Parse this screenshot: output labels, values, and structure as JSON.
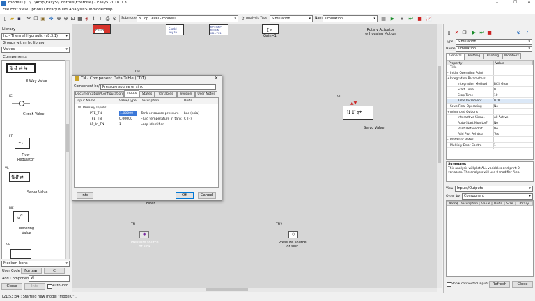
{
  "window": {
    "title": "model0 (C:\\...\\Amp\\Easy5\\Controls\\Exercise) - Easy5 2018.0.3",
    "min": "–",
    "max": "☐",
    "close": "✕"
  },
  "menu": [
    "File",
    "Edit",
    "View",
    "Options",
    "Library",
    "Build",
    "Analysis",
    "Submodel",
    "Help"
  ],
  "toolbar": {
    "submodel_label": "Submodel",
    "submodel_value": "> Top Level - model0",
    "analysis_label": "Analysis Type",
    "analysis_value": "Simulation",
    "name_label": "Name",
    "name_value": "simulation"
  },
  "library_panel": {
    "title": "Library",
    "library_value": "hc - Thermal Hydraulic (v8.3.1)",
    "groups_label": "Groups within hc library",
    "groups_value": "Valves",
    "components_title": "Components",
    "items": [
      {
        "tag": "",
        "name": "8-Way Valve"
      },
      {
        "tag": "IC",
        "name": "Check Valve"
      },
      {
        "tag": "FF",
        "name": "Flow Regulator"
      },
      {
        "tag": "VL",
        "name": "Servo Valve"
      },
      {
        "tag": "MF",
        "name": "Metering Valve"
      },
      {
        "tag": "VF",
        "name": ""
      }
    ],
    "icon_size": "Medium Icons",
    "user_code_label": "User Code",
    "fortran": "Fortran",
    "c": "C",
    "add_component_label": "Add Component",
    "add_component_value": "VI",
    "close": "Close",
    "info": "Info",
    "auto_info": "Auto-Info"
  },
  "canvas": {
    "blocks": [
      {
        "tag": "",
        "name": "Fluid"
      },
      {
        "tag": "",
        "name": "S-add\nkey16"
      },
      {
        "tag": "",
        "name": "CONTROL\nKP=GKP\nKI=GKI\nKD=TC1"
      },
      {
        "tag": "",
        "name": "Gain=1"
      },
      {
        "tag": "",
        "name": "Rotary Actuator\nw Housing Motion"
      },
      {
        "tag": "VI",
        "name": "Servo Valve"
      },
      {
        "tag": "",
        "name": "Filter"
      },
      {
        "tag": "TN",
        "name": "Pressure source\nor sink"
      },
      {
        "tag": "TN2",
        "name": "Pressure source\nor sink"
      }
    ],
    "ch_tag": "CH"
  },
  "dialog": {
    "title": "TN - Component Data Table (CDT)",
    "component_label": "Component hc/TN",
    "component_value": "Pressure source or sink",
    "tabs": [
      "Documentation/Configuration",
      "Inputs",
      "States",
      "Variables",
      "Version",
      "User Notes"
    ],
    "active_tab": 1,
    "columns": [
      "Input Name",
      "Value/Type",
      "Description",
      "Units"
    ],
    "group": "Primary Inputs",
    "rows": [
      {
        "name": "PTE_TN",
        "value": "1.00000",
        "desc": "Tank or source pressure",
        "units": "bar (psia)"
      },
      {
        "name": "TFE_TN",
        "value": "0.00000",
        "desc": "Fluid temperature in tank",
        "units": "C (F)"
      },
      {
        "name": "LP_In_TN",
        "value": "1",
        "desc": "Loop identifier",
        "units": ""
      }
    ],
    "info": "Info",
    "ok": "OK",
    "cancel": "Cancel"
  },
  "right_panel": {
    "type_label": "Type",
    "type_value": "Simulation",
    "name_label": "Name",
    "name_value": "simulation",
    "tabs": [
      "General",
      "Plotting",
      "Printing",
      "Modifiers"
    ],
    "columns": [
      "Property",
      "Value"
    ],
    "properties": [
      {
        "indent": 0,
        "exp": "-",
        "name": "Title",
        "value": ""
      },
      {
        "indent": 0,
        "exp": "-",
        "name": "Initial Operating Point",
        "value": ""
      },
      {
        "indent": 0,
        "exp": "+",
        "name": "Integration Parameters",
        "value": ""
      },
      {
        "indent": 1,
        "exp": "",
        "name": "Integration Method",
        "value": "BCS Gear"
      },
      {
        "indent": 1,
        "exp": "",
        "name": "Start Time",
        "value": "0"
      },
      {
        "indent": 1,
        "exp": "",
        "name": "Stop Time",
        "value": "10"
      },
      {
        "indent": 1,
        "exp": "",
        "name": "Time Increment",
        "value": "0.01"
      },
      {
        "indent": 0,
        "exp": "-",
        "name": "Save Final Operating",
        "value": "No"
      },
      {
        "indent": 0,
        "exp": "+",
        "name": "Advanced Options",
        "value": ""
      },
      {
        "indent": 1,
        "exp": "",
        "name": "Interactive Simul.",
        "value": "All Active"
      },
      {
        "indent": 1,
        "exp": "",
        "name": "Auto-Start Monitor?",
        "value": "No"
      },
      {
        "indent": 1,
        "exp": "",
        "name": "Print Detailed St.",
        "value": "No"
      },
      {
        "indent": 1,
        "exp": "",
        "name": "Add Plot Points a",
        "value": "Yes"
      },
      {
        "indent": 0,
        "exp": "-",
        "name": "Plot/Print Rates",
        "value": ""
      },
      {
        "indent": 0,
        "exp": "-",
        "name": "Multiply Error Contro",
        "value": "1"
      }
    ],
    "summary_title": "Summary:",
    "summary_text": "This analysis will plot ALL variables and print 0 variables. The analysis will use 0 modifier files.",
    "view_label": "View",
    "view_value": "Inputs/Outputs",
    "order_label": "Order by",
    "order_value": "Component",
    "io_columns": [
      "Name",
      "Description",
      "Value",
      "Units",
      "Size",
      "Library"
    ],
    "show_connected": "Show connected inputs",
    "refresh": "Refresh",
    "close": "Close"
  },
  "status": "[21:53:34]: Starting new model \"model0\"..."
}
